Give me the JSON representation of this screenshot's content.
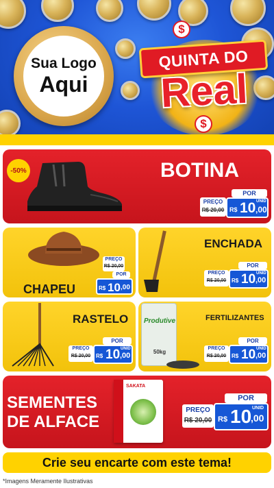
{
  "header": {
    "logo_line1": "Sua Logo",
    "logo_line2": "Aqui",
    "brand_top": "QUINTA DO",
    "brand_main": "Real",
    "brand_symbol": "$",
    "colors": {
      "blue": "#1e55d6",
      "red": "#e01b24",
      "yellow": "#ffd200"
    }
  },
  "products": [
    {
      "title": "BOTINA",
      "badge": "-50%",
      "por": "POR",
      "preco_label": "PREÇO",
      "old_price": "R$ 20,00",
      "currency": "R$",
      "price": "10",
      "cents": ",00",
      "unit": "UNID",
      "image_icon": "boot-icon"
    },
    {
      "title": "CHAPEU",
      "por": "POR",
      "preco_label": "PREÇO",
      "old_price": "R$ 20,00",
      "currency": "R$",
      "price": "10",
      "cents": ",00",
      "unit": "UNID",
      "image_icon": "hat-icon"
    },
    {
      "title": "ENCHADA",
      "por": "POR",
      "preco_label": "PREÇO",
      "old_price": "R$ 20,00",
      "currency": "R$",
      "price": "10",
      "cents": ",00",
      "unit": "UNID",
      "image_icon": "hoe-icon"
    },
    {
      "title": "RASTELO",
      "por": "POR",
      "preco_label": "PREÇO",
      "old_price": "R$ 20,00",
      "currency": "R$",
      "price": "10",
      "cents": ",00",
      "unit": "UNID",
      "image_icon": "rake-icon"
    },
    {
      "title": "FERTILIZANTES",
      "por": "POR",
      "preco_label": "PREÇO",
      "old_price": "R$ 20,00",
      "currency": "R$",
      "price": "10",
      "cents": ",00",
      "unit": "UNID",
      "image_icon": "fertilizer-bag-icon",
      "bag_text": "Produtive",
      "bag_weight": "50kg"
    },
    {
      "title_line1": "SEMENTES",
      "title_line2": "DE ALFACE",
      "por": "POR",
      "preco_label": "PREÇO",
      "old_price": "R$ 20,00",
      "currency": "R$",
      "price": "10",
      "cents": ",00",
      "unit": "UNID",
      "image_icon": "seed-packet-icon",
      "packet_brand": "SAKATA"
    }
  ],
  "bottom_banner": "Crie seu encarte com este tema!",
  "footer_note": "*Imagens Meramente Ilustrativas"
}
